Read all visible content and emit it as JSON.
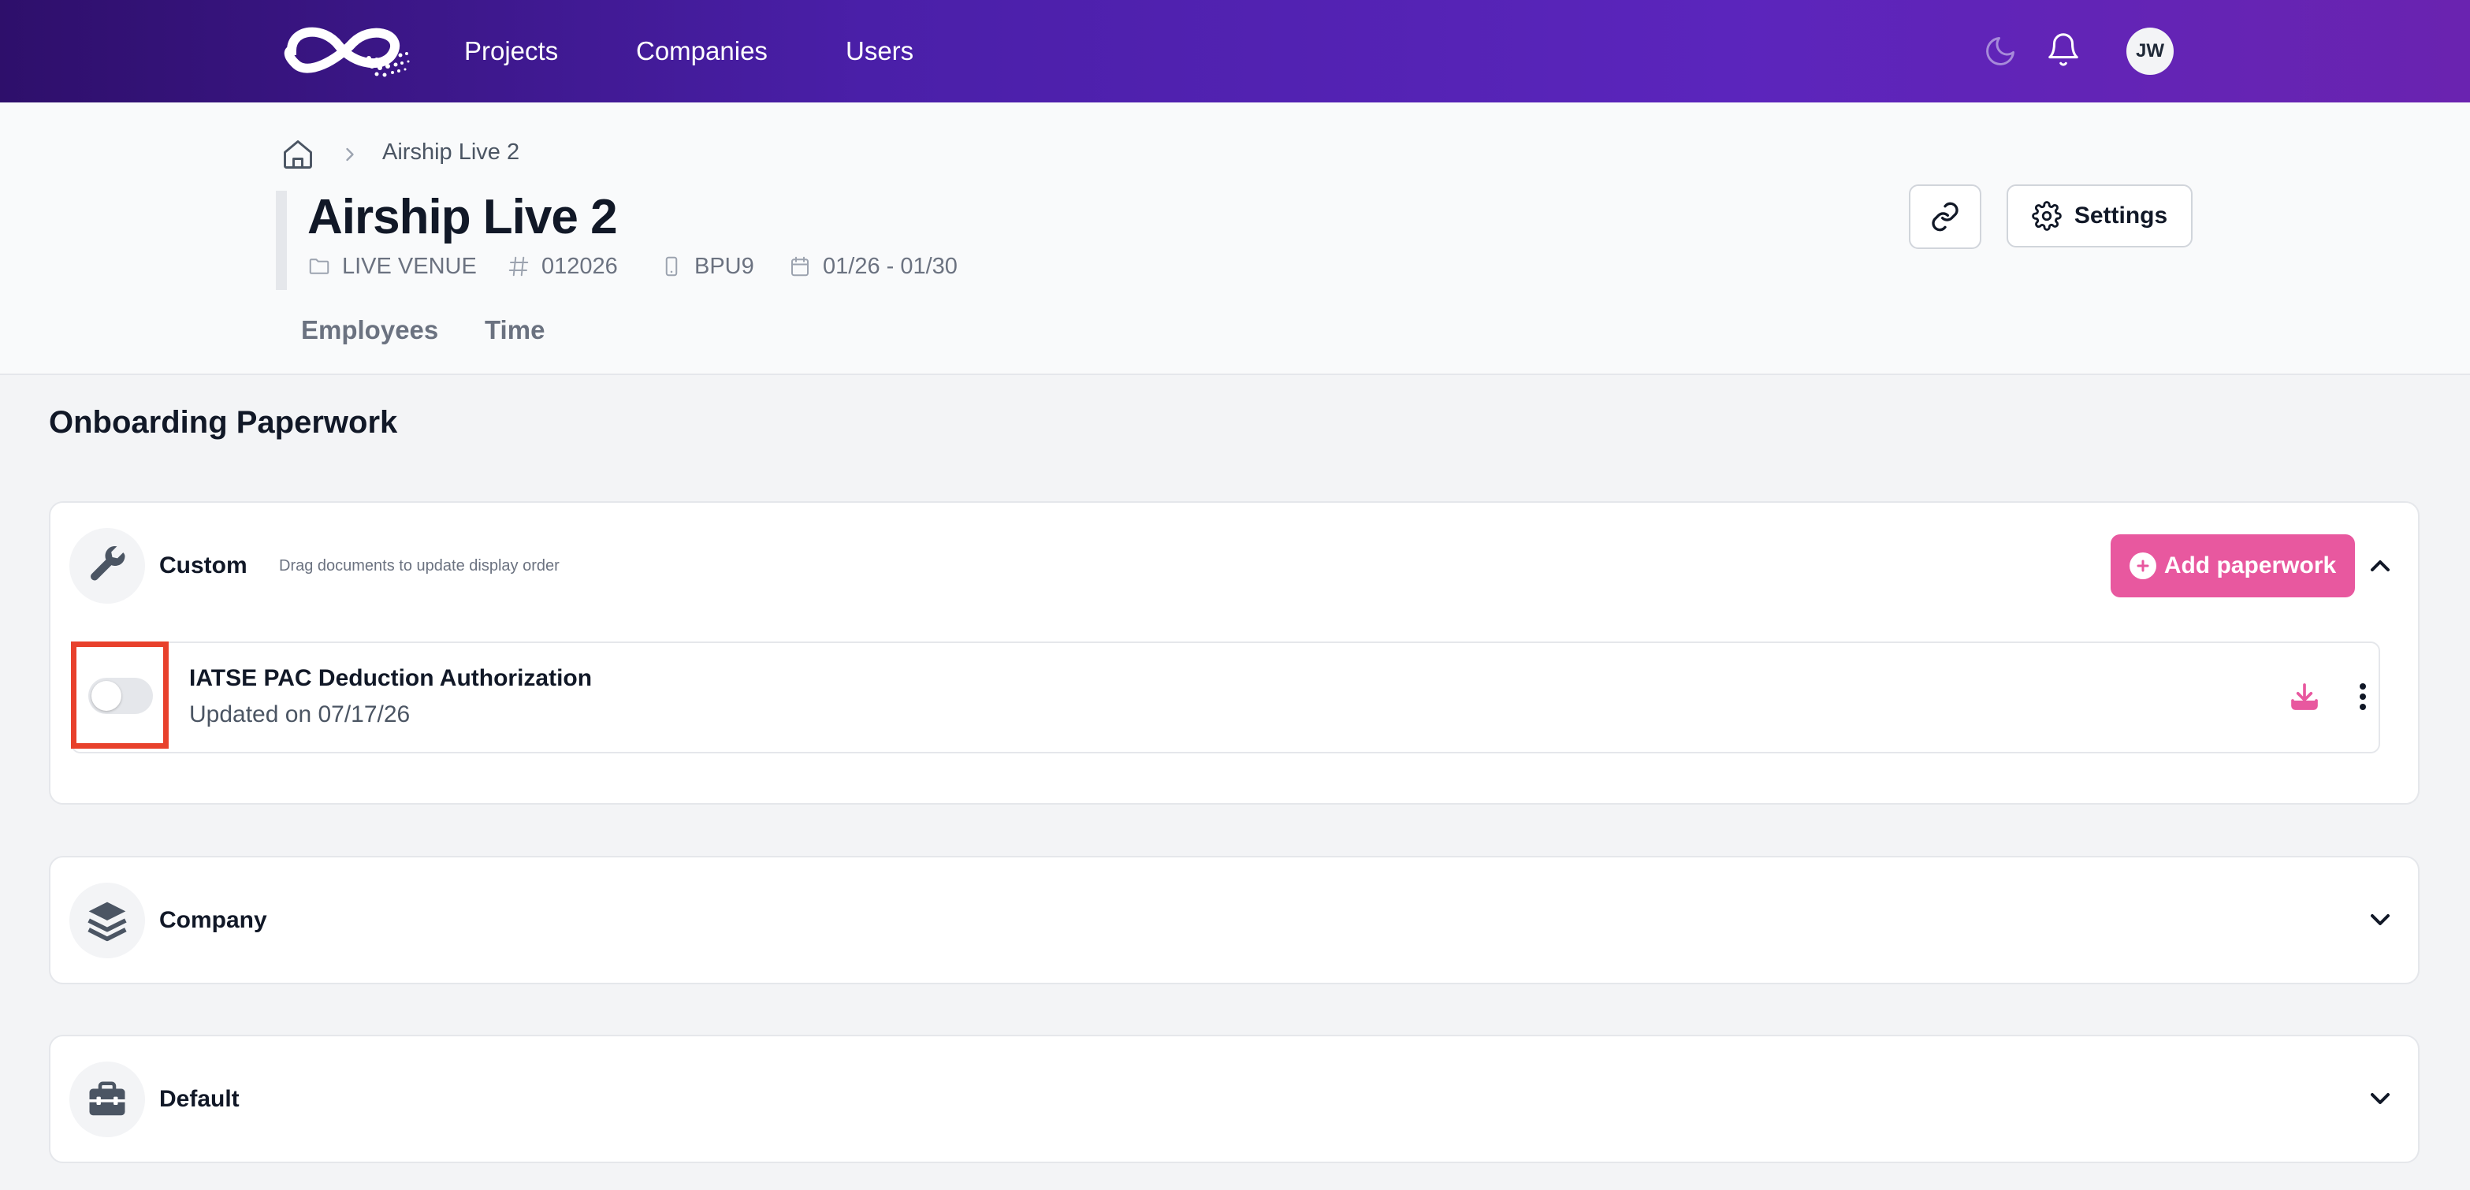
{
  "nav": {
    "links": [
      "Projects",
      "Companies",
      "Users"
    ],
    "user_initials": "JW"
  },
  "breadcrumb": {
    "current": "Airship Live 2"
  },
  "project": {
    "title": "Airship Live 2",
    "venue_type": "LIVE VENUE",
    "number": "012026",
    "device": "BPU9",
    "dates": "01/26 - 01/30",
    "settings_label": "Settings"
  },
  "tabs": [
    "Employees",
    "Time"
  ],
  "section": {
    "title": "Onboarding Paperwork"
  },
  "cards": {
    "custom": {
      "label": "Custom",
      "hint": "Drag documents to update display order",
      "add_label": "Add paperwork",
      "expanded": true,
      "documents": [
        {
          "name": "IATSE PAC Deduction Authorization",
          "updated": "Updated on 07/17/26",
          "enabled": false
        }
      ]
    },
    "company": {
      "label": "Company",
      "expanded": false
    },
    "default": {
      "label": "Default",
      "expanded": false
    }
  },
  "colors": {
    "accent_pink": "#e8589f",
    "highlight_red": "#e8412c",
    "nav_gradient_start": "#2e0f6b",
    "nav_gradient_end": "#6a23b0"
  }
}
